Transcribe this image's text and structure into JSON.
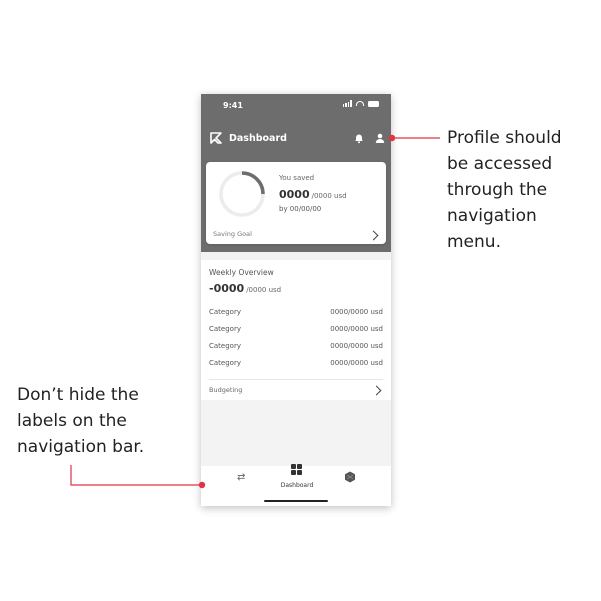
{
  "status": {
    "time": "9:41"
  },
  "header": {
    "title": "Dashboard",
    "icons": [
      "bell-icon",
      "profile-icon"
    ]
  },
  "saving_card": {
    "label": "You saved",
    "amount": "0000",
    "amount_suffix": "/0000 usd",
    "date": "by 00/00/00",
    "footer": "Saving Goal",
    "progress": 0.25
  },
  "weekly": {
    "title": "Weekly Overview",
    "amount": "-0000",
    "amount_suffix": "/0000 usd",
    "rows": [
      {
        "category": "Category",
        "value": "0000/0000 usd"
      },
      {
        "category": "Category",
        "value": "0000/0000 usd"
      },
      {
        "category": "Category",
        "value": "0000/0000 usd"
      },
      {
        "category": "Category",
        "value": "0000/0000 usd"
      }
    ],
    "footer": "Budgeting"
  },
  "nav": {
    "active_label": "Dashboard",
    "items": [
      "transfer-icon",
      "dashboard-icon",
      "hexagon-icon"
    ]
  },
  "annotations": {
    "profile_note": [
      "Profile should",
      "be accessed",
      "through the",
      "navigation",
      "menu."
    ],
    "labels_note": [
      "Don’t hide the",
      "labels on the",
      "navigation bar."
    ]
  },
  "colors": {
    "header": "#6d6d6d",
    "annotation_line": "#e03345",
    "background": "#f3f3f4"
  }
}
